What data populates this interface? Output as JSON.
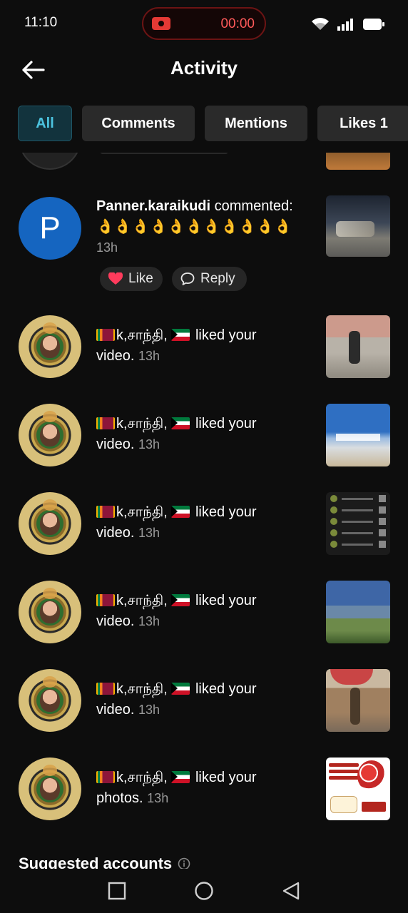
{
  "status_bar": {
    "time": "11:10",
    "recording_time": "00:00"
  },
  "header": {
    "title": "Activity"
  },
  "tabs": [
    {
      "label": "All",
      "active": true
    },
    {
      "label": "Comments",
      "active": false
    },
    {
      "label": "Mentions",
      "active": false
    },
    {
      "label": "Likes 1",
      "active": false
    }
  ],
  "comment": {
    "username": "Panner.karaikudi",
    "action": " commented:",
    "emojis": "👌👌👌👌👌👌👌👌👌👌👌",
    "time": "13h",
    "avatar_letter": "P",
    "like_label": "Like",
    "reply_label": "Reply"
  },
  "activity_items": [
    {
      "name": "k,சாந்தி,",
      "text": " liked your",
      "object": "video.",
      "time": "13h"
    },
    {
      "name": "k,சாந்தி,",
      "text": " liked your",
      "object": "video.",
      "time": "13h"
    },
    {
      "name": "k,சாந்தி,",
      "text": " liked your",
      "object": "video.",
      "time": "13h"
    },
    {
      "name": "k,சாந்தி,",
      "text": " liked your",
      "object": "video.",
      "time": "13h"
    },
    {
      "name": "k,சாந்தி,",
      "text": " liked your",
      "object": "video.",
      "time": "13h"
    },
    {
      "name": "k,சாந்தி,",
      "text": " liked your",
      "object": "photos.",
      "time": "13h"
    }
  ],
  "suggested": {
    "title": "Suggested accounts"
  },
  "colors": {
    "background": "#0d0d0d",
    "tab_active_text": "#4cc3df",
    "tab_active_bg": "#12333d",
    "like_heart": "#ff3b5c",
    "recording_red": "#e53935"
  },
  "icons": [
    "back-arrow-icon",
    "wifi-icon",
    "signal-icon",
    "battery-icon",
    "heart-icon",
    "chat-bubble-icon",
    "info-icon",
    "recent-apps-icon",
    "home-circle-icon",
    "back-triangle-icon"
  ]
}
